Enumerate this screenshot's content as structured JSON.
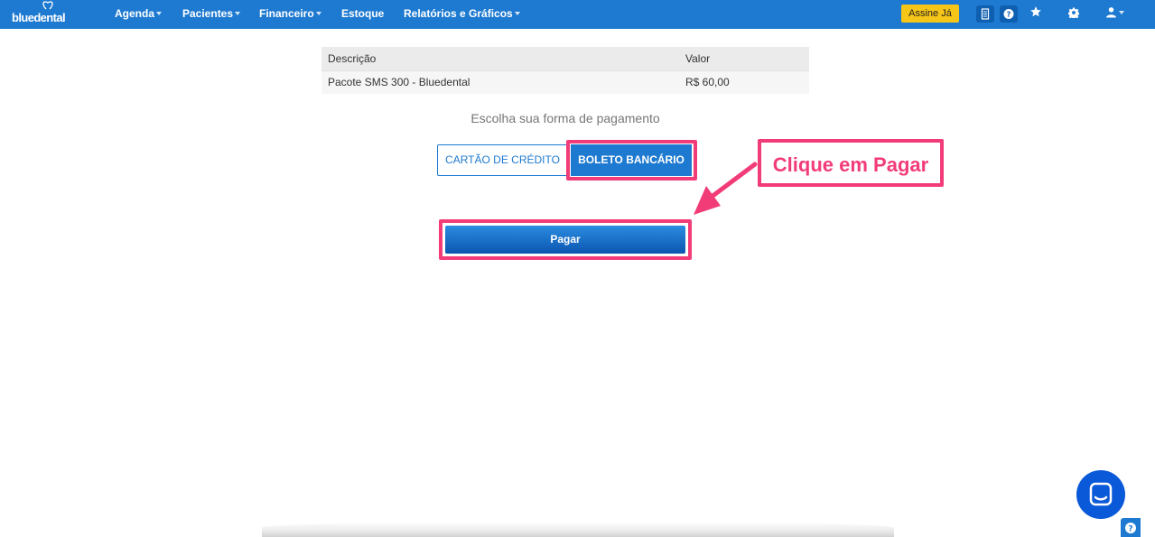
{
  "nav": {
    "brand": "bluedental",
    "items": [
      {
        "label": "Agenda",
        "dropdown": true
      },
      {
        "label": "Pacientes",
        "dropdown": true
      },
      {
        "label": "Financeiro",
        "dropdown": true
      },
      {
        "label": "Estoque",
        "dropdown": false
      },
      {
        "label": "Relatórios e Gráficos",
        "dropdown": true
      }
    ],
    "subscribe_label": "Assine Já",
    "icons": [
      "notes-icon",
      "help-icon",
      "star-icon",
      "gear-icon",
      "user-icon"
    ]
  },
  "table": {
    "headers": [
      "Descrição",
      "Valor"
    ],
    "rows": [
      [
        "Pacote SMS 300 - Bluedental",
        "R$ 60,00"
      ]
    ]
  },
  "payment": {
    "prompt": "Escolha sua forma de pagamento",
    "options": [
      {
        "label": "CARTÃO DE CRÉDITO",
        "selected": false
      },
      {
        "label": "BOLETO BANCÁRIO",
        "selected": true
      }
    ],
    "pay_label": "Pagar"
  },
  "annotation": {
    "callout_text": "Clique em Pagar"
  },
  "colors": {
    "brand_blue": "#1e7ad0",
    "highlight_pink": "#f23c78",
    "subscribe_yellow": "#f5c518"
  }
}
